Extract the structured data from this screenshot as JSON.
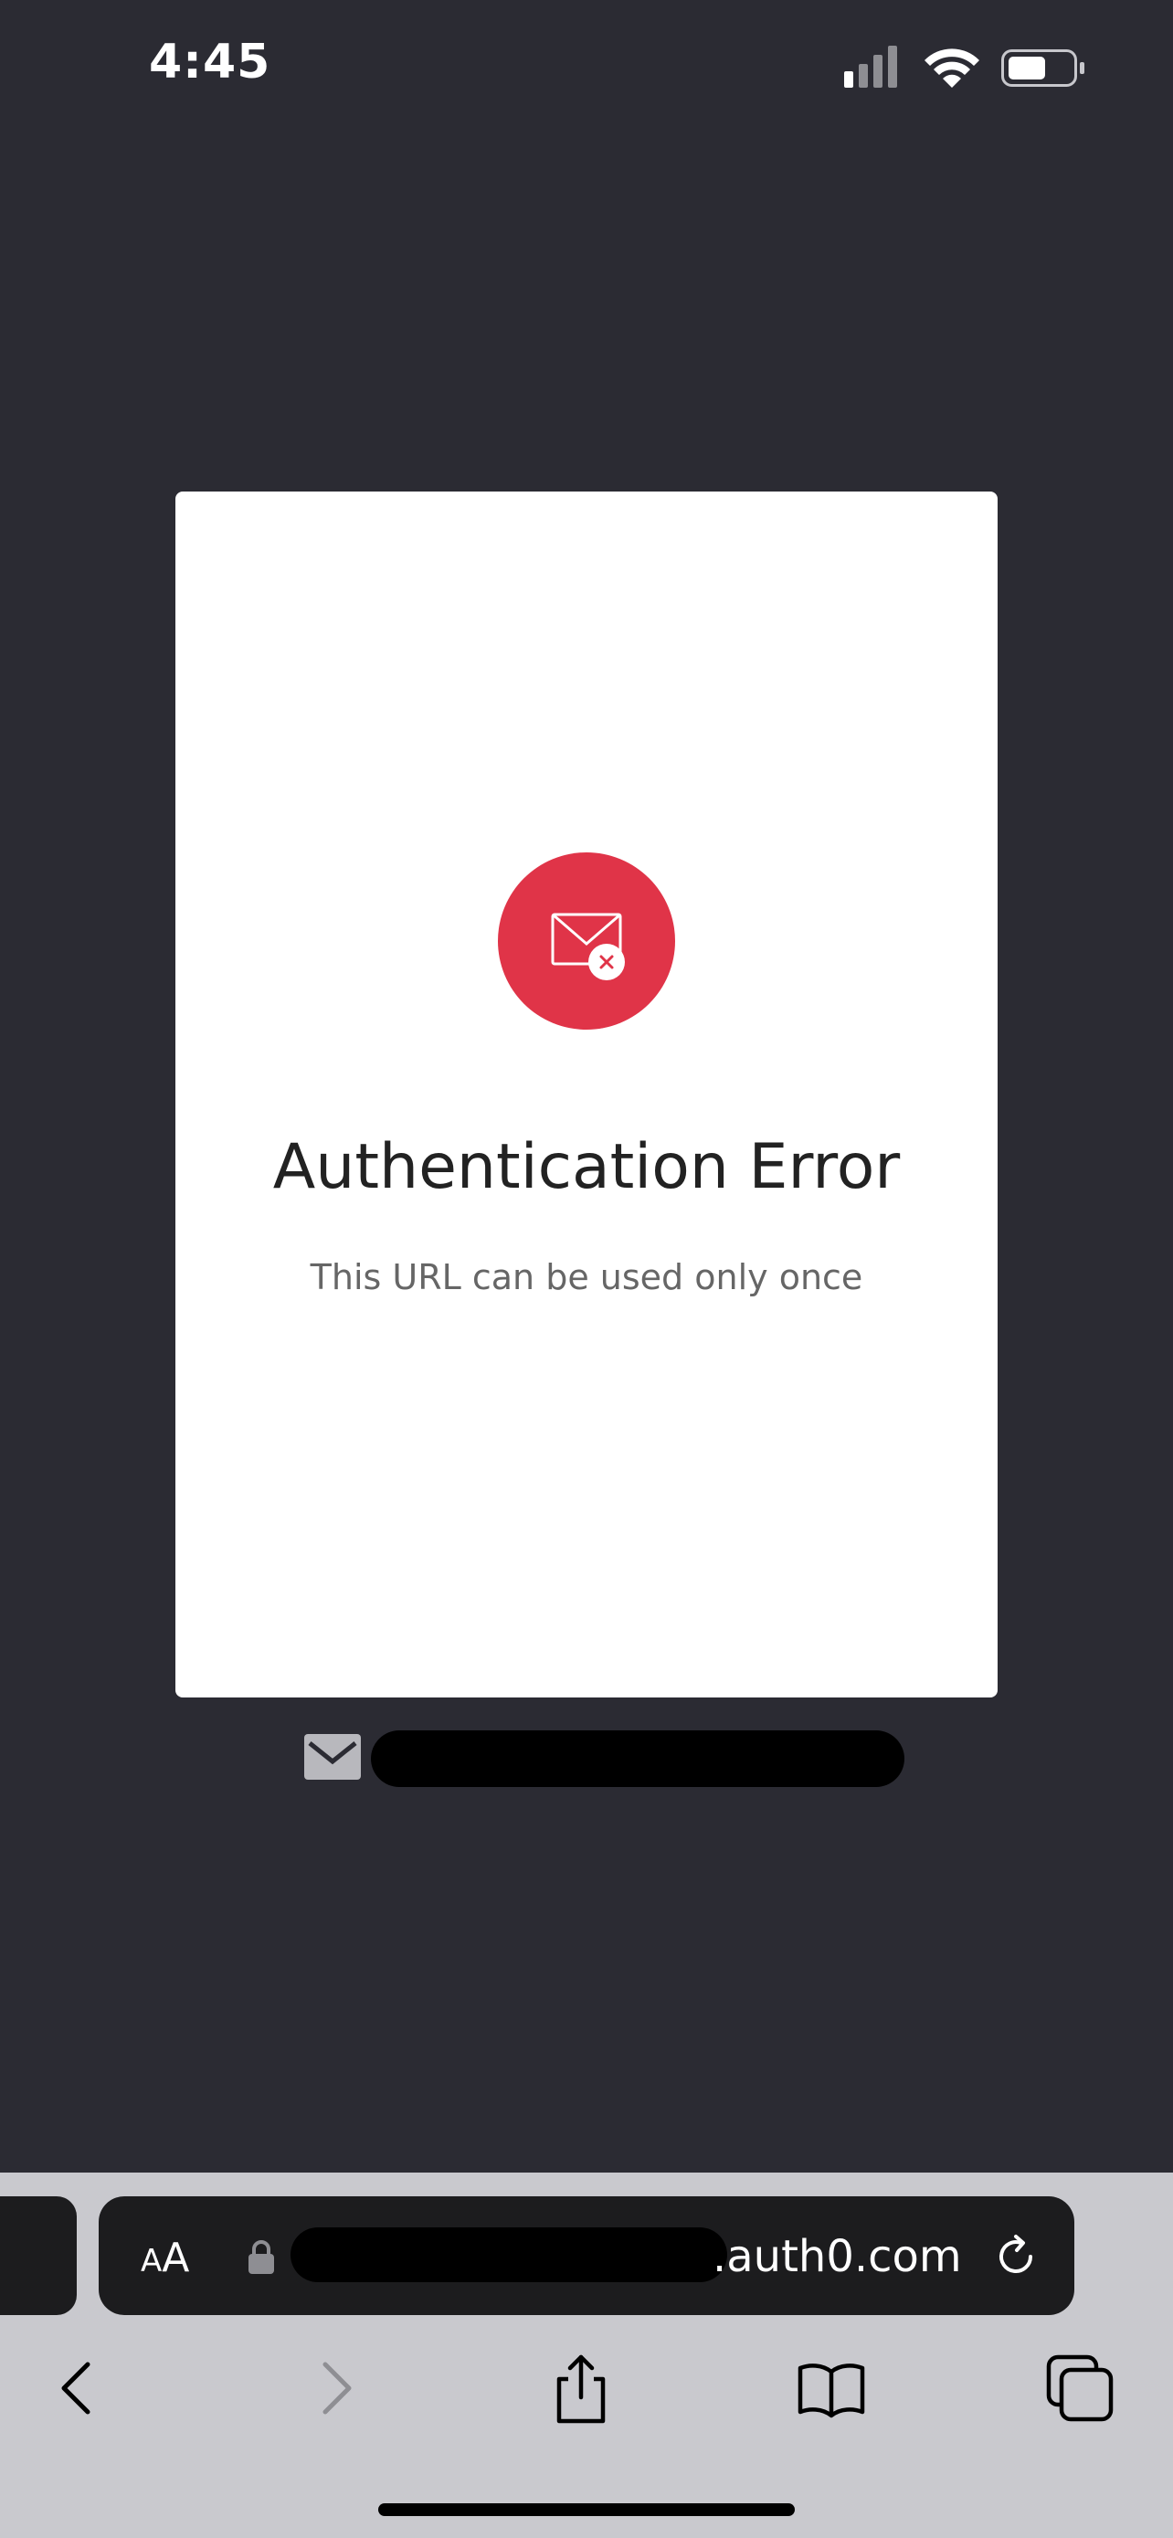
{
  "status_bar": {
    "time": "4:45"
  },
  "auth_card": {
    "title": "Authentication Error",
    "message": "This URL can be used only once",
    "icon": "mail-error-icon",
    "accent_color": "#e03448"
  },
  "safari": {
    "aa_label_small": "A",
    "aa_label_large": "A",
    "url_suffix": ".auth0.com",
    "toolbar": {
      "back": "back-chevron-icon",
      "forward": "forward-chevron-icon",
      "share": "share-icon",
      "bookmarks": "bookmarks-icon",
      "tabs": "tabs-icon"
    }
  },
  "colors": {
    "page_background": "#2b2b33",
    "card_background": "#ffffff",
    "toolbar_background": "#c9c9ce",
    "address_bar_background": "#1c1c1e"
  }
}
